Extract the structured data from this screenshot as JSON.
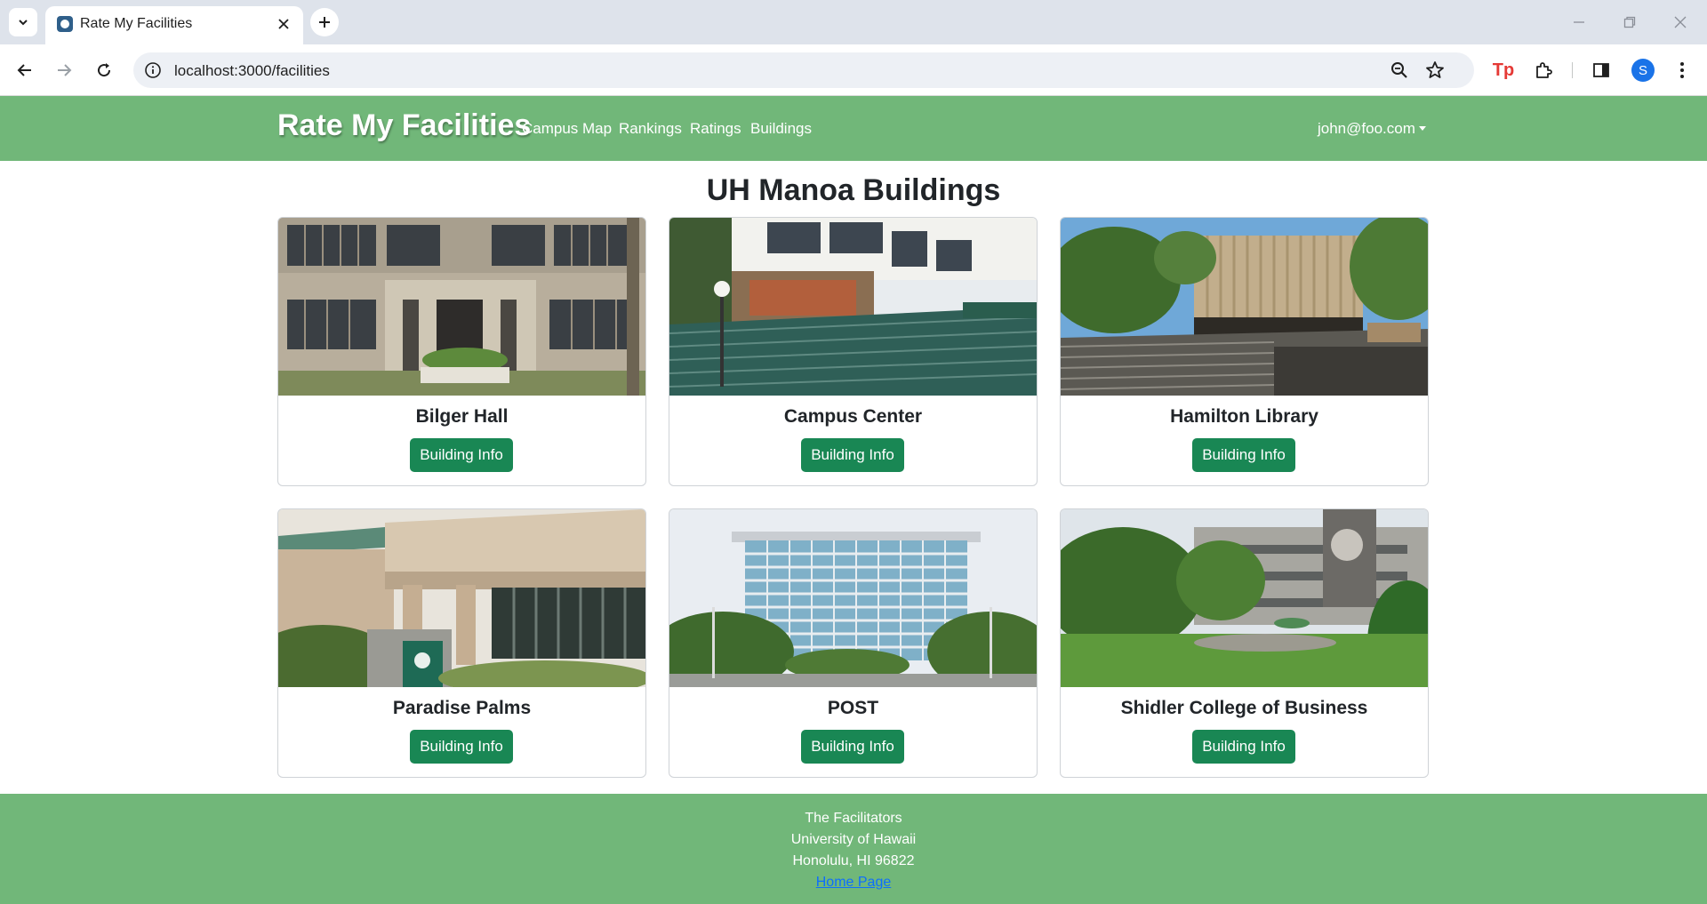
{
  "browser": {
    "tab_title": "Rate My Facilities",
    "url": "localhost:3000/facilities",
    "profile_initial": "S",
    "extension_label": "Tp"
  },
  "navbar": {
    "brand": "Rate My Facilities",
    "links": [
      "Campus Map",
      "Rankings",
      "Ratings",
      "Buildings"
    ],
    "user": "john@foo.com"
  },
  "page": {
    "title": "UH Manoa Buildings",
    "button_label": "Building Info",
    "buildings": [
      {
        "name": "Bilger Hall"
      },
      {
        "name": "Campus Center"
      },
      {
        "name": "Hamilton Library"
      },
      {
        "name": "Paradise Palms"
      },
      {
        "name": "POST"
      },
      {
        "name": "Shidler College of Business"
      }
    ]
  },
  "footer": {
    "line1": "The Facilitators",
    "line2": "University of Hawaii",
    "line3": "Honolulu, HI 96822",
    "link": "Home Page"
  },
  "colors": {
    "brand_green": "#71b779",
    "button_green": "#198754",
    "link_blue": "#0d6efd"
  }
}
